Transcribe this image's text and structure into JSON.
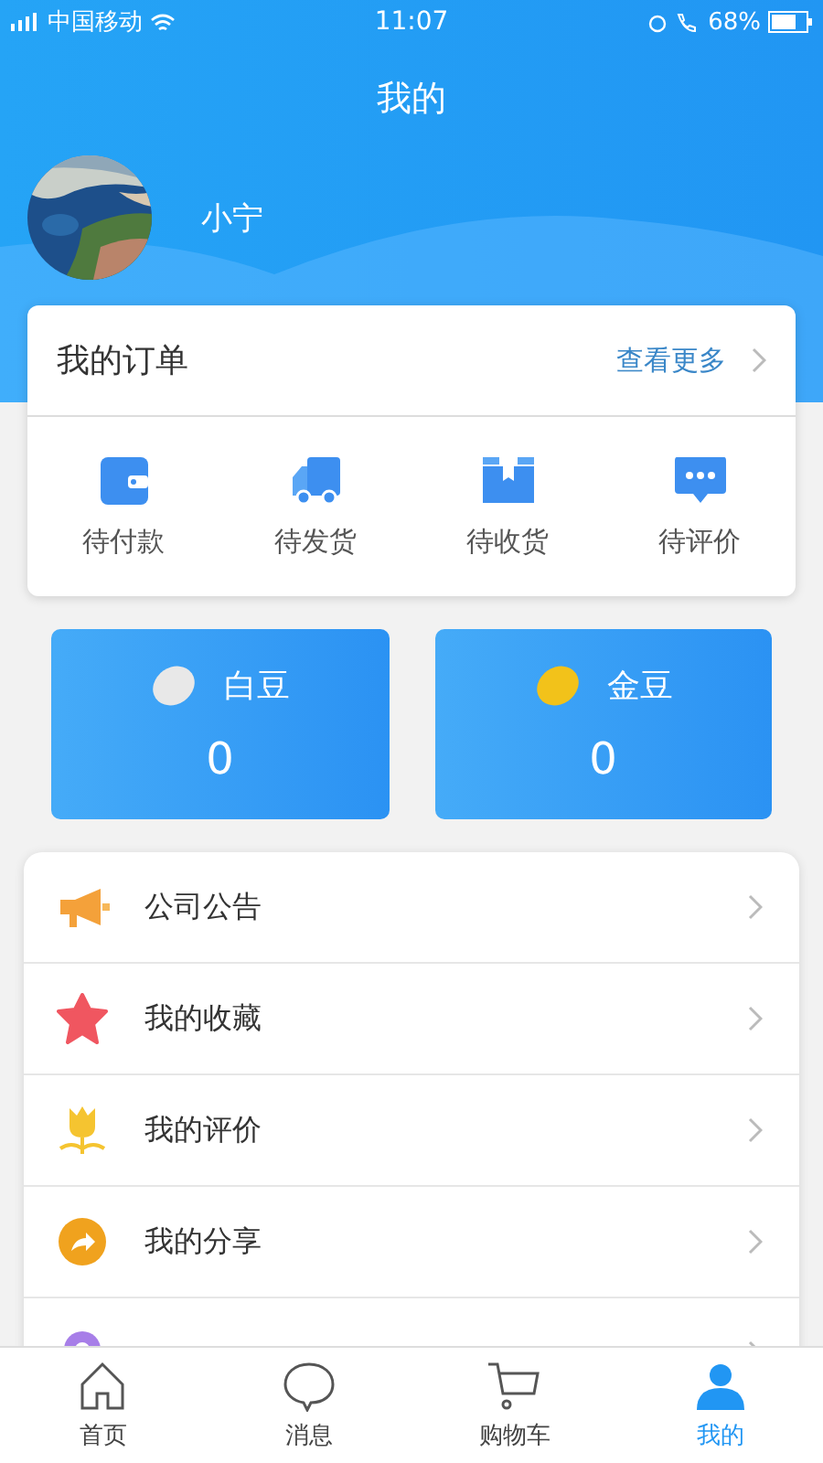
{
  "status_bar": {
    "carrier": "中国移动",
    "time": "11:07",
    "battery": "68%"
  },
  "header": {
    "title": "我的",
    "user_name": "小宁"
  },
  "orders": {
    "title": "我的订单",
    "more": "查看更多",
    "items": [
      {
        "label": "待付款",
        "kind": "wallet"
      },
      {
        "label": "待发货",
        "kind": "truck"
      },
      {
        "label": "待收货",
        "kind": "box"
      },
      {
        "label": "待评价",
        "kind": "chat"
      }
    ]
  },
  "beans": [
    {
      "label": "白豆",
      "value": "0",
      "color": "#e8e8e8"
    },
    {
      "label": "金豆",
      "value": "0",
      "color": "#f2c21a"
    }
  ],
  "menu": [
    {
      "label": "公司公告",
      "kind": "megaphone"
    },
    {
      "label": "我的收藏",
      "kind": "star"
    },
    {
      "label": "我的评价",
      "kind": "flower"
    },
    {
      "label": "我的分享",
      "kind": "share"
    },
    {
      "kind": "pin"
    }
  ],
  "tab_bar": [
    {
      "label": "首页",
      "kind": "home",
      "selected": false
    },
    {
      "label": "消息",
      "kind": "chat",
      "selected": false
    },
    {
      "label": "购物车",
      "kind": "cart",
      "selected": false
    },
    {
      "label": "我的",
      "kind": "user",
      "selected": true
    }
  ]
}
